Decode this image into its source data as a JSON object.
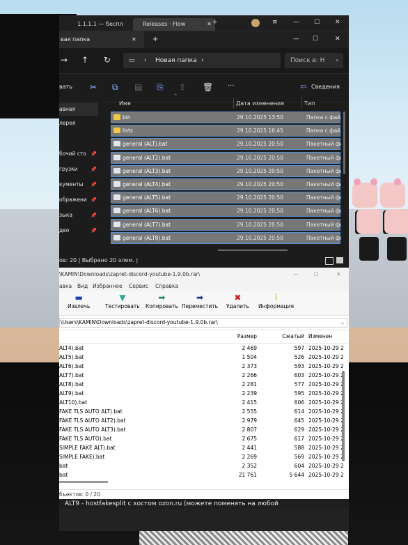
{
  "browser": {
    "tabs": [
      {
        "label": "1.1.1.1 — беспл"
      },
      {
        "label": "Releases · Flow"
      }
    ],
    "close_glyph": "✕",
    "new_tab_glyph": "+",
    "menu_glyph": "≡",
    "minimize_glyph": "—",
    "maximize_glyph": "☐",
    "window_close_glyph": "✕"
  },
  "explorer": {
    "tab_title": "вая папка",
    "breadcrumb": "Новая папка",
    "search_placeholder": "Поиск в: Н",
    "details_label": "Сведения",
    "more_label": "···",
    "view_label": "вать",
    "columns": {
      "name": "Имя",
      "date": "Дата изменения",
      "type": "Тип"
    },
    "sidebar": [
      {
        "label": "авная",
        "selected": true,
        "pinned": false
      },
      {
        "label": "лерея",
        "selected": false,
        "pinned": false
      },
      {
        "label": "бочий сто",
        "selected": false,
        "pinned": true
      },
      {
        "label": "грузки",
        "selected": false,
        "pinned": true
      },
      {
        "label": "кументы",
        "selected": false,
        "pinned": true
      },
      {
        "label": "ображени",
        "selected": false,
        "pinned": true
      },
      {
        "label": "зыка",
        "selected": false,
        "pinned": true
      },
      {
        "label": "део",
        "selected": false,
        "pinned": true
      }
    ],
    "files": [
      {
        "name": "bin",
        "date": "29.10.2025 13:50",
        "type": "Папка с файл",
        "kind": "folder"
      },
      {
        "name": "lists",
        "date": "29.10.2025 16:45",
        "type": "Папка с файл",
        "kind": "folder"
      },
      {
        "name": "general (ALT).bat",
        "date": "29.10.2025 20:50",
        "type": "Пакетный фа",
        "kind": "bat"
      },
      {
        "name": "general (ALT2).bat",
        "date": "29.10.2025 20:50",
        "type": "Пакетный фа",
        "kind": "bat"
      },
      {
        "name": "general (ALT3).bat",
        "date": "29.10.2025 20:50",
        "type": "Пакетный фа",
        "kind": "bat"
      },
      {
        "name": "general (ALT4).bat",
        "date": "29.10.2025 20:50",
        "type": "Пакетный фа",
        "kind": "bat"
      },
      {
        "name": "general (ALT5).bat",
        "date": "29.10.2025 20:50",
        "type": "Пакетный фа",
        "kind": "bat"
      },
      {
        "name": "general (ALT6).bat",
        "date": "29.10.2025 20:50",
        "type": "Пакетный фа",
        "kind": "bat"
      },
      {
        "name": "general (ALT7).bat",
        "date": "29.10.2025 20:50",
        "type": "Пакетный фа",
        "kind": "bat"
      },
      {
        "name": "general (ALT8).bat",
        "date": "29.10.2025 20:50",
        "type": "Пакетный фа",
        "kind": "bat"
      }
    ],
    "status": "ов: 20  |  Выбрано 20 элем.  |"
  },
  "archiver": {
    "title": "\\KAMIN\\Downloads\\zapret-discord-youtube-1.9.0b.rar\\",
    "menu": [
      "авка",
      "Вид",
      "Избранное",
      "Сервис",
      "Справка"
    ],
    "tools": [
      {
        "label": "Извлечь",
        "icon": "extract-icon",
        "glyph": "▬",
        "color": "#1a3fb0"
      },
      {
        "label": "Тестировать",
        "icon": "test-icon",
        "glyph": "▼",
        "color": "#2aa6a0"
      },
      {
        "label": "Копировать",
        "icon": "copy-icon",
        "glyph": "➡",
        "color": "#1a8a6a"
      },
      {
        "label": "Переместить",
        "icon": "move-icon",
        "glyph": "➡",
        "color": "#1a2fa0"
      },
      {
        "label": "Удалить",
        "icon": "delete-icon",
        "glyph": "✖",
        "color": "#d02020"
      },
      {
        "label": "Информация",
        "icon": "info-icon",
        "glyph": "i",
        "color": "#c8a800"
      }
    ],
    "path": "\\Users\\KAMIN\\Downloads\\zapret-discord-youtube-1.9.0b.rar\\",
    "columns": {
      "size": "Размер",
      "packed": "Сжатый",
      "modified": "Изменен"
    },
    "rows": [
      {
        "name": "ALT4).bat",
        "size": "2 469",
        "packed": "597",
        "modified": "2025-10-29 2"
      },
      {
        "name": "ALT5).bat",
        "size": "1 504",
        "packed": "526",
        "modified": "2025-10-29 2"
      },
      {
        "name": "ALT6).bat",
        "size": "2 373",
        "packed": "593",
        "modified": "2025-10-29 2"
      },
      {
        "name": "ALT7).bat",
        "size": "2 266",
        "packed": "603",
        "modified": "2025-10-29 2"
      },
      {
        "name": "ALT8).bat",
        "size": "2 281",
        "packed": "577",
        "modified": "2025-10-29 2"
      },
      {
        "name": "ALT9).bat",
        "size": "2 239",
        "packed": "595",
        "modified": "2025-10-29 2"
      },
      {
        "name": "ALT10).bat",
        "size": "2 415",
        "packed": "606",
        "modified": "2025-10-29 2"
      },
      {
        "name": "FAKE TLS AUTO ALT).bat",
        "size": "2 555",
        "packed": "614",
        "modified": "2025-10-29 2"
      },
      {
        "name": "FAKE TLS AUTO ALT2).bat",
        "size": "2 979",
        "packed": "645",
        "modified": "2025-10-29 2"
      },
      {
        "name": "FAKE TLS AUTO ALT3).bat",
        "size": "2 807",
        "packed": "629",
        "modified": "2025-10-29 2"
      },
      {
        "name": "FAKE TLS AUTO).bat",
        "size": "2 675",
        "packed": "617",
        "modified": "2025-10-29 2"
      },
      {
        "name": "SIMPLE FAKE ALT).bat",
        "size": "2 441",
        "packed": "588",
        "modified": "2025-10-29 2"
      },
      {
        "name": "SIMPLE FAKE).bat",
        "size": "2 269",
        "packed": "569",
        "modified": "2025-10-29 2"
      },
      {
        "name": "bat",
        "size": "2 352",
        "packed": "604",
        "modified": "2025-10-29 2"
      },
      {
        "name": "bat",
        "size": "21 761",
        "packed": "5 644",
        "modified": "2025-10-29 2"
      }
    ],
    "status": "бъектов: 0 / 20",
    "bottom_text": "ALT9 - hostfakesplit с хостом ozon.ru (можете поменять на любой"
  }
}
